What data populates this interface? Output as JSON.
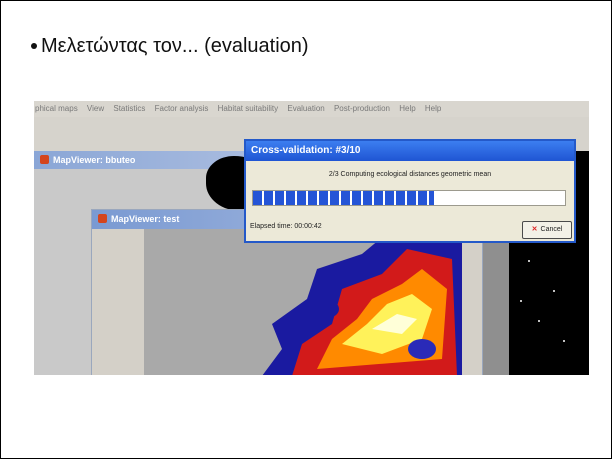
{
  "slide": {
    "bullet": "Μελετώντας τον... (evaluation)"
  },
  "app": {
    "menu": [
      "phical maps",
      "View",
      "Statistics",
      "Factor analysis",
      "Habitat suitability",
      "Evaluation",
      "Post-production",
      "Help",
      "Help"
    ],
    "window_back_title": "MapViewer: bbuteo",
    "window_front_title": "MapViewer: test"
  },
  "dialog": {
    "title": "Cross-validation: #3/10",
    "message": "2/3 Computing ecological distances geometric mean",
    "elapsed": "Elapsed time: 00:00:42",
    "cancel_label": "Cancel",
    "progress": 0.58
  },
  "colors": {
    "dialog_title": "#2459c9",
    "progress_blue": "#2454d6",
    "heatmap_low": "#1a1aa0",
    "heatmap_high": "#ffff60"
  }
}
